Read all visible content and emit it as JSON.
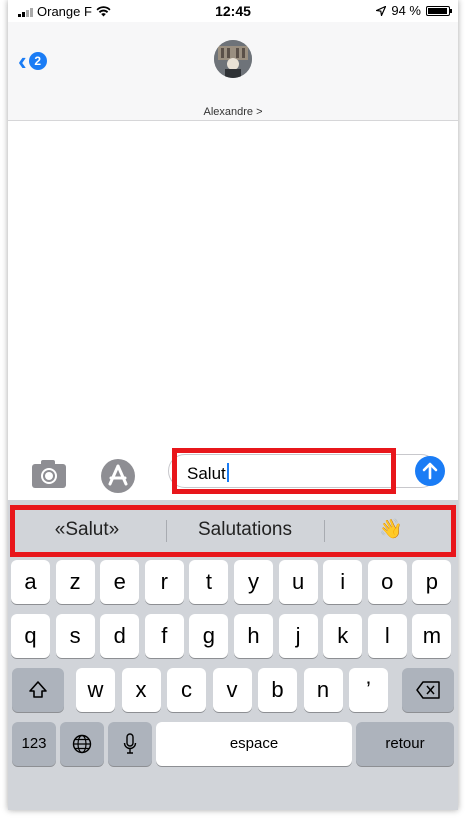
{
  "status_bar": {
    "carrier": "Orange F",
    "time": "12:45",
    "battery": "94 %",
    "battery_level": 0.94
  },
  "header": {
    "unread_count": "2",
    "contact_name": "Alexandre >"
  },
  "composer": {
    "message_text": "Salut"
  },
  "suggestions": [
    "«Salut»",
    "Salutations",
    "👋"
  ],
  "keyboard": {
    "row1": [
      "a",
      "z",
      "e",
      "r",
      "t",
      "y",
      "u",
      "i",
      "o",
      "p"
    ],
    "row2": [
      "q",
      "s",
      "d",
      "f",
      "g",
      "h",
      "j",
      "k",
      "l",
      "m"
    ],
    "row3": [
      "w",
      "x",
      "c",
      "v",
      "b",
      "n",
      "’"
    ],
    "numbers_label": "123",
    "space_label": "espace",
    "return_label": "retour"
  },
  "colors": {
    "accent": "#1a7cf5",
    "highlight": "#e8161b",
    "keyboard_bg": "#d1d4d9"
  },
  "icons": [
    "wifi-icon",
    "location-arrow-icon",
    "battery-icon",
    "chevron-left-icon",
    "camera-icon",
    "app-store-icon",
    "send-arrow-icon",
    "shift-icon",
    "backspace-icon",
    "globe-icon",
    "microphone-icon"
  ]
}
